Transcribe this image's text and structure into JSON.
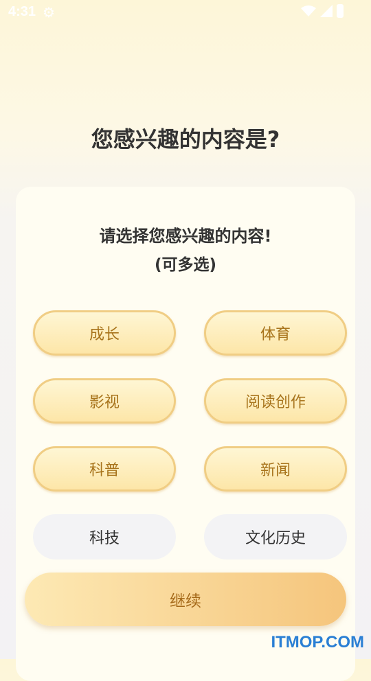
{
  "status_bar": {
    "time": "4:31",
    "icons": [
      "gear-icon",
      "wifi-icon",
      "signal-icon",
      "battery-icon"
    ]
  },
  "page_title": "您感兴趣的内容是?",
  "card": {
    "title": "请选择您感兴趣的内容!",
    "subtitle": "(可多选)"
  },
  "interests": [
    {
      "label": "成长",
      "selected": true
    },
    {
      "label": "体育",
      "selected": true
    },
    {
      "label": "影视",
      "selected": true
    },
    {
      "label": "阅读创作",
      "selected": true
    },
    {
      "label": "科普",
      "selected": true
    },
    {
      "label": "新闻",
      "selected": true
    },
    {
      "label": "科技",
      "selected": false
    },
    {
      "label": "文化历史",
      "selected": false
    }
  ],
  "continue_button": "继续",
  "watermark": "ITMOP.COM",
  "colors": {
    "selected_text": "#a8741c",
    "selected_border": "#f0cd84",
    "button_start": "#fde9b4",
    "button_end": "#f5c57c",
    "watermark": "#2a7fd4"
  }
}
